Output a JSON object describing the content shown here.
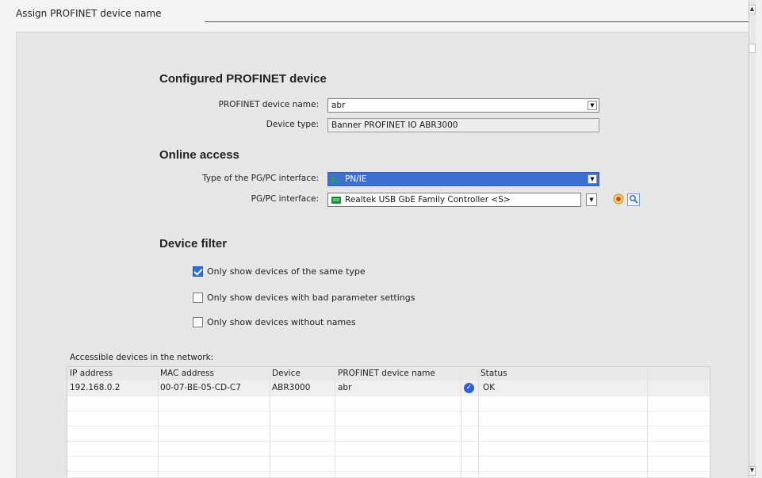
{
  "window": {
    "title": "Assign PROFINET device name"
  },
  "configured": {
    "heading": "Configured PROFINET device",
    "name_label": "PROFINET device name:",
    "name_value": "abr",
    "type_label": "Device type:",
    "type_value": "Banner PROFINET IO ABR3000"
  },
  "online": {
    "heading": "Online access",
    "iface_type_label": "Type of the PG/PC interface:",
    "iface_type_value": "PN/IE",
    "iface_label": "PG/PC interface:",
    "iface_value": "Realtek USB GbE Family Controller <S>"
  },
  "filter": {
    "heading": "Device filter",
    "options": [
      {
        "label": "Only show devices of the same type",
        "checked": true
      },
      {
        "label": "Only show devices with bad parameter settings",
        "checked": false
      },
      {
        "label": "Only show devices without names",
        "checked": false
      }
    ]
  },
  "network": {
    "title": "Accessible devices in the network:",
    "columns": [
      "IP address",
      "MAC address",
      "Device",
      "PROFINET device name",
      "Status"
    ],
    "rows": [
      {
        "ip": "192.168.0.2",
        "mac": "00-07-BE-05-CD-C7",
        "device": "ABR3000",
        "name": "abr",
        "status": "OK"
      }
    ]
  },
  "icons": {
    "dropdown": "chevron-down-icon",
    "connection": "connection-status-icon",
    "diagnostics": "magnifier-icon",
    "status_ok": "checkmark-icon"
  },
  "colors": {
    "selection": "#3c6fd1",
    "status_ok": "#2f5fd0",
    "network_green": "#22a34a"
  }
}
